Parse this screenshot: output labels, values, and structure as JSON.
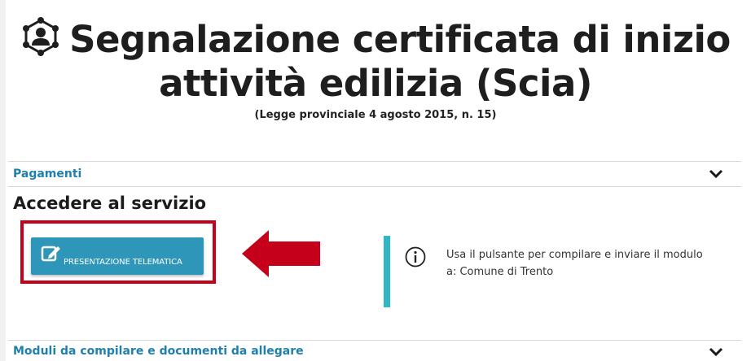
{
  "header": {
    "title_line1": "Segnalazione certificata di inizio",
    "title_line2": "attività edilizia (Scia)",
    "subtitle": "(Legge provinciale 4 agosto 2015, n. 15)",
    "title_icon": "network-user-icon"
  },
  "sections": {
    "pagamenti": "Pagamenti",
    "moduli": "Moduli da compilare e documenti da allegare"
  },
  "access": {
    "heading": "Accedere al servizio",
    "button_label": "PRESENTAZIONE TELEMATICA",
    "button_icon": "edit-icon",
    "info_text": "Usa il pulsante per compilare e inviare il modulo a: Comune di Trento",
    "info_icon": "info-icon"
  },
  "colors": {
    "accent": "#2e96b8",
    "section_link": "#1f7fae",
    "highlight_red": "#c5001a",
    "info_bar": "#2fb7c3"
  }
}
